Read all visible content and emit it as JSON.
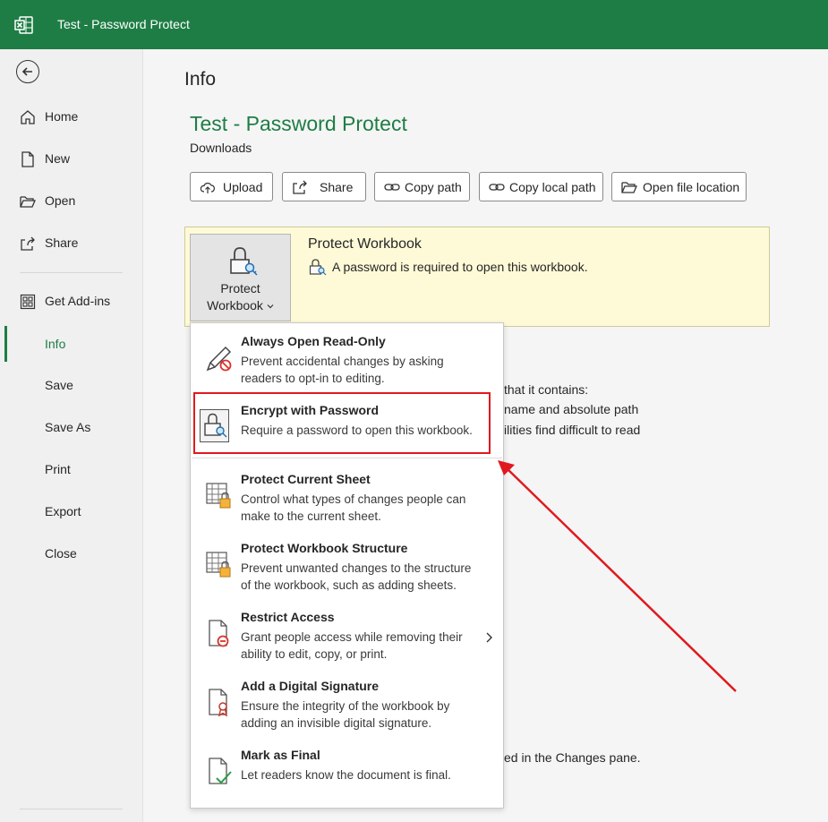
{
  "window": {
    "title": "Test - Password Protect",
    "app_icon": "excel-logo-icon",
    "accent": "#1e7d45"
  },
  "sidebar": {
    "back_icon": "back-arrow-icon",
    "items": [
      {
        "label": "Home",
        "icon": "home-icon"
      },
      {
        "label": "New",
        "icon": "new-document-icon"
      },
      {
        "label": "Open",
        "icon": "folder-open-icon"
      },
      {
        "label": "Share",
        "icon": "share-icon"
      },
      {
        "label": "Get Add-ins",
        "icon": "add-ins-grid-icon"
      },
      {
        "label": "Info",
        "active": true
      },
      {
        "label": "Save"
      },
      {
        "label": "Save As"
      },
      {
        "label": "Print"
      },
      {
        "label": "Export"
      },
      {
        "label": "Close"
      }
    ]
  },
  "main": {
    "heading": "Info",
    "document_title": "Test - Password Protect",
    "location": "Downloads",
    "actions": [
      {
        "label": "Upload",
        "icon": "upload-icon"
      },
      {
        "label": "Share",
        "icon": "share-icon"
      },
      {
        "label": "Copy path",
        "icon": "link-icon"
      },
      {
        "label": "Copy local path",
        "icon": "link-icon"
      },
      {
        "label": "Open file location",
        "icon": "folder-icon"
      }
    ],
    "protect_panel": {
      "button_line1": "Protect",
      "button_line2": "Workbook",
      "heading": "Protect Workbook",
      "status": "A password is required to open this workbook."
    },
    "background_fragments": [
      "that it contains:",
      "name and absolute path",
      "ilities find difficult to read",
      "ed in the Changes pane."
    ]
  },
  "protect_menu": {
    "items": [
      {
        "title": "Always Open Read-Only",
        "line1": "Prevent accidental changes by asking",
        "line2": "readers to opt-in to editing.",
        "icon": "pencil-no-edit-icon"
      },
      {
        "title": "Encrypt with Password",
        "line1": "Require a password to open this workbook.",
        "line2": "",
        "icon": "lock-key-icon"
      },
      {
        "title": "Protect Current Sheet",
        "line1": "Control what types of changes people can",
        "line2": "make to the current sheet.",
        "icon": "sheet-lock-icon"
      },
      {
        "title": "Protect Workbook Structure",
        "line1": "Prevent unwanted changes to the structure",
        "line2": "of the workbook, such as adding sheets.",
        "icon": "workbook-lock-icon"
      },
      {
        "title": "Restrict Access",
        "line1": "Grant people access while removing their",
        "line2": "ability to edit, copy, or print.",
        "icon": "restrict-document-icon"
      },
      {
        "title": "Add a Digital Signature",
        "line1": "Ensure the integrity of the workbook by",
        "line2": "adding an invisible digital signature.",
        "icon": "signature-ribbon-icon"
      },
      {
        "title": "Mark as Final",
        "line1": "Let readers know the document is final.",
        "line2": "",
        "icon": "final-checkmark-icon"
      }
    ]
  },
  "annotation": {
    "color": "#e0191e"
  }
}
